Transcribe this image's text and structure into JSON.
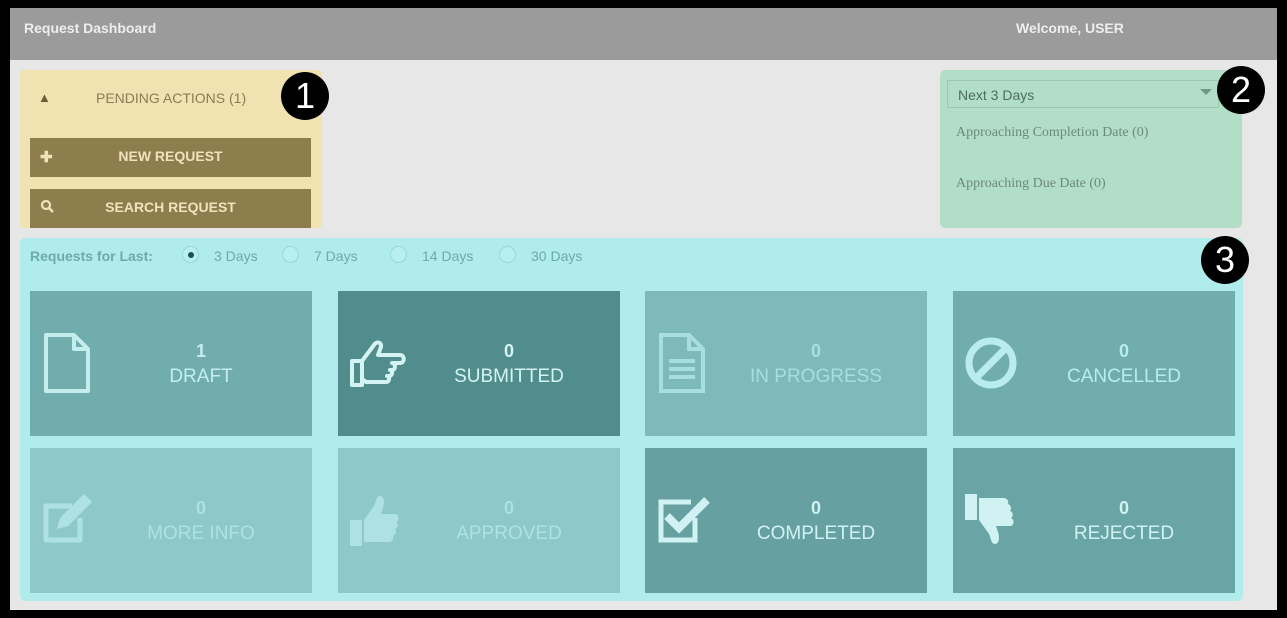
{
  "header": {
    "title": "Request Dashboard",
    "welcome": "Welcome, USER"
  },
  "actions": {
    "pending": "PENDING ACTIONS (1)",
    "new_request": "NEW REQUEST",
    "search_request": "SEARCH REQUEST"
  },
  "upcoming": {
    "selected": "Next 3 Days",
    "completion": "Approaching Completion Date (0)",
    "due": "Approaching Due Date (0)"
  },
  "filter": {
    "label": "Requests for Last:",
    "options": [
      "3 Days",
      "7 Days",
      "14 Days",
      "30 Days"
    ],
    "selected": "3 Days"
  },
  "tiles": [
    {
      "count": "1",
      "label": "DRAFT",
      "icon": "file-icon",
      "bg": "#72adad",
      "fg": "#c4eeee"
    },
    {
      "count": "0",
      "label": "SUBMITTED",
      "icon": "hand-pointing-icon",
      "bg": "#528d8d",
      "fg": "#d4f4f4"
    },
    {
      "count": "0",
      "label": "IN PROGRESS",
      "icon": "document-icon",
      "bg": "#7fbaba",
      "fg": "#a9dede"
    },
    {
      "count": "0",
      "label": "CANCELLED",
      "icon": "ban-icon",
      "bg": "#72adad",
      "fg": "#b9ecec"
    },
    {
      "count": "0",
      "label": "MORE INFO",
      "icon": "edit-icon",
      "bg": "#8ec8c8",
      "fg": "#aee2e2"
    },
    {
      "count": "0",
      "label": "APPROVED",
      "icon": "thumbs-up-icon",
      "bg": "#8ec8c8",
      "fg": "#aee2e2"
    },
    {
      "count": "0",
      "label": "COMPLETED",
      "icon": "check-square-icon",
      "bg": "#66a0a0",
      "fg": "#d0f2f2"
    },
    {
      "count": "0",
      "label": "REJECTED",
      "icon": "thumbs-down-icon",
      "bg": "#6aa5a5",
      "fg": "#d0f2f2"
    }
  ],
  "callouts": [
    "1",
    "2",
    "3"
  ]
}
